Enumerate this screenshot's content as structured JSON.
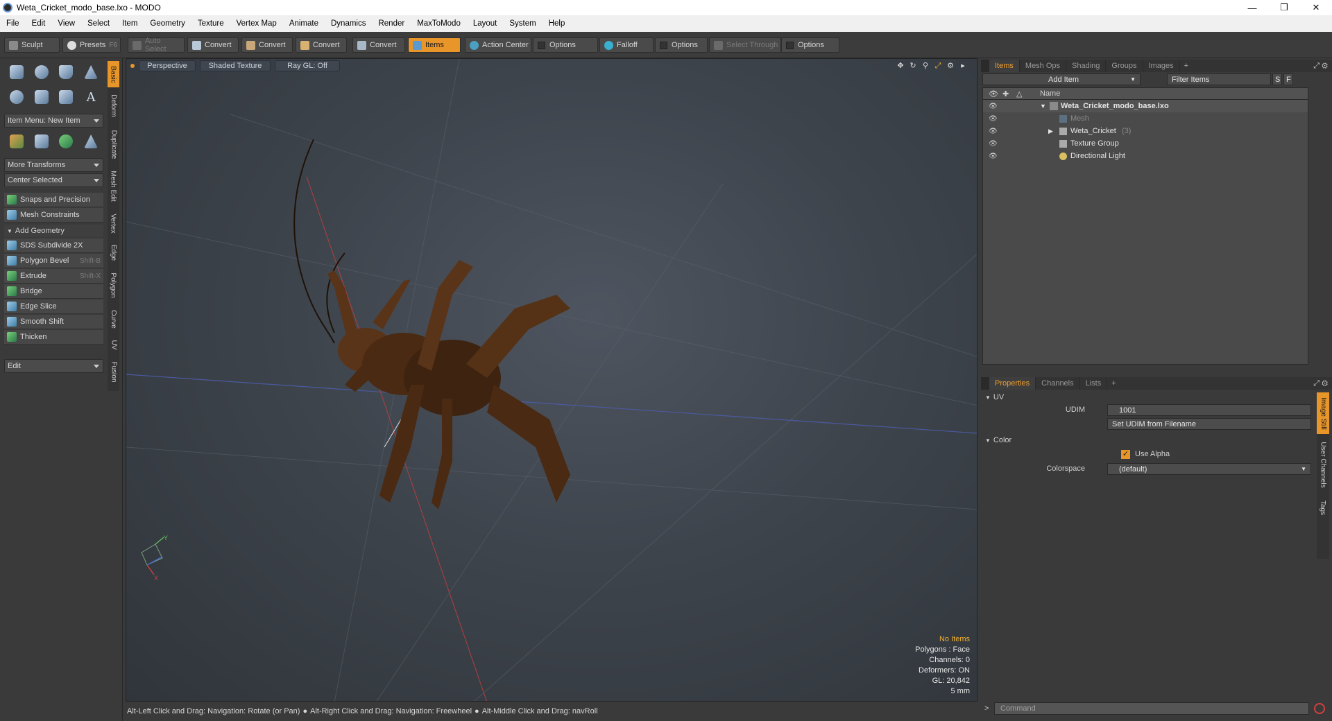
{
  "window": {
    "title": "Weta_Cricket_modo_base.lxo - MODO"
  },
  "menu": [
    "File",
    "Edit",
    "View",
    "Select",
    "Item",
    "Geometry",
    "Texture",
    "Vertex Map",
    "Animate",
    "Dynamics",
    "Render",
    "MaxToModo",
    "Layout",
    "System",
    "Help"
  ],
  "toolbar": {
    "sculpt": "Sculpt",
    "presets": "Presets",
    "presets_shortcut": "F6",
    "auto_select": "Auto Select",
    "convert1": "Convert",
    "convert2": "Convert",
    "convert3": "Convert",
    "convert4": "Convert",
    "items": "Items",
    "action_center": "Action Center",
    "options1": "Options",
    "falloff": "Falloff",
    "options2": "Options",
    "select_through": "Select Through",
    "options3": "Options"
  },
  "left": {
    "item_menu": "Item Menu: New Item",
    "more_transforms": "More Transforms",
    "center_selected": "Center Selected",
    "snaps": "Snaps and Precision",
    "mesh_constraints": "Mesh Constraints",
    "add_geometry": "Add Geometry",
    "tools": [
      {
        "label": "SDS Subdivide 2X",
        "shortcut": ""
      },
      {
        "label": "Polygon Bevel",
        "shortcut": "Shift-B"
      },
      {
        "label": "Extrude",
        "shortcut": "Shift-X"
      },
      {
        "label": "Bridge",
        "shortcut": ""
      },
      {
        "label": "Edge Slice",
        "shortcut": ""
      },
      {
        "label": "Smooth Shift",
        "shortcut": ""
      },
      {
        "label": "Thicken",
        "shortcut": ""
      }
    ],
    "edit": "Edit",
    "vtabs": [
      "Basic",
      "Deform",
      "Duplicate",
      "Mesh Edit",
      "Vertex",
      "Edge",
      "Polygon",
      "Curve",
      "UV",
      "Fusion"
    ]
  },
  "viewport": {
    "view": "Perspective",
    "shading": "Shaded Texture",
    "raygl": "Ray GL: Off",
    "info": {
      "items": "No Items",
      "polygons": "Polygons : Face",
      "channels": "Channels: 0",
      "deformers": "Deformers: ON",
      "gl": "GL: 20,842",
      "unit": "5 mm"
    }
  },
  "status": {
    "hint1": "Alt-Left Click and Drag: Navigation: Rotate (or Pan)",
    "hint2": "Alt-Right Click and Drag: Navigation: Freewheel",
    "hint3": "Alt-Middle Click and Drag: navRoll"
  },
  "items_panel": {
    "tabs": [
      "Items",
      "Mesh Ops",
      "Shading",
      "Groups",
      "Images"
    ],
    "add_item": "Add Item",
    "filter_items": "Filter Items",
    "filter_s": "S",
    "filter_f": "F",
    "name_header": "Name",
    "tree": [
      {
        "label": "Weta_Cricket_modo_base.lxo",
        "count": ""
      },
      {
        "label": "Mesh",
        "count": ""
      },
      {
        "label": "Weta_Cricket",
        "count": "(3)"
      },
      {
        "label": "Texture Group",
        "count": ""
      },
      {
        "label": "Directional Light",
        "count": ""
      }
    ]
  },
  "props_panel": {
    "tabs": [
      "Properties",
      "Channels",
      "Lists"
    ],
    "uv_section": "UV",
    "udim_label": "UDIM",
    "udim_value": "1001",
    "set_udim": "Set UDIM from Filename",
    "color_section": "Color",
    "use_alpha": "Use Alpha",
    "colorspace_label": "Colorspace",
    "colorspace_value": "(default)",
    "side_tabs": [
      "Image Still",
      "User Channels",
      "Tags"
    ]
  },
  "command": {
    "placeholder": "Command"
  }
}
